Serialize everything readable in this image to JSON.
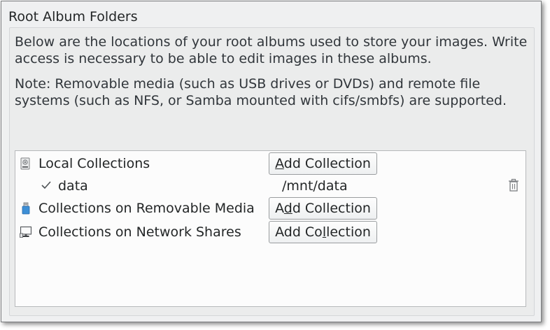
{
  "group": {
    "title": "Root Album Folders"
  },
  "description": "Below are the locations of your root albums used to store your images. Write access is necessary to be able to edit images in these albums.",
  "note": "Note: Removable media (such as USB drives or DVDs) and remote file systems (such as NFS, or Samba mounted with cifs/smbfs) are supported.",
  "collections": {
    "local": {
      "label": "Local Collections",
      "icon": "hard-drive-icon",
      "button": {
        "pre": "",
        "mnemonic": "A",
        "post": "dd Collection"
      },
      "children": [
        {
          "name": "data",
          "path": "/mnt/data",
          "status_icon": "check-icon",
          "action_icon": "trash-icon"
        }
      ]
    },
    "removable": {
      "label": "Collections on Removable Media",
      "icon": "usb-drive-icon",
      "button": {
        "pre": "A",
        "mnemonic": "d",
        "post": "d Collection"
      }
    },
    "network": {
      "label": "Collections on Network Shares",
      "icon": "network-computer-icon",
      "button": {
        "pre": "Add Co",
        "mnemonic": "l",
        "post": "lection"
      }
    }
  },
  "colors": {
    "window_bg": "#eff0f1",
    "list_bg": "#fcfcfc",
    "usb_blue": "#3d8fd6"
  }
}
